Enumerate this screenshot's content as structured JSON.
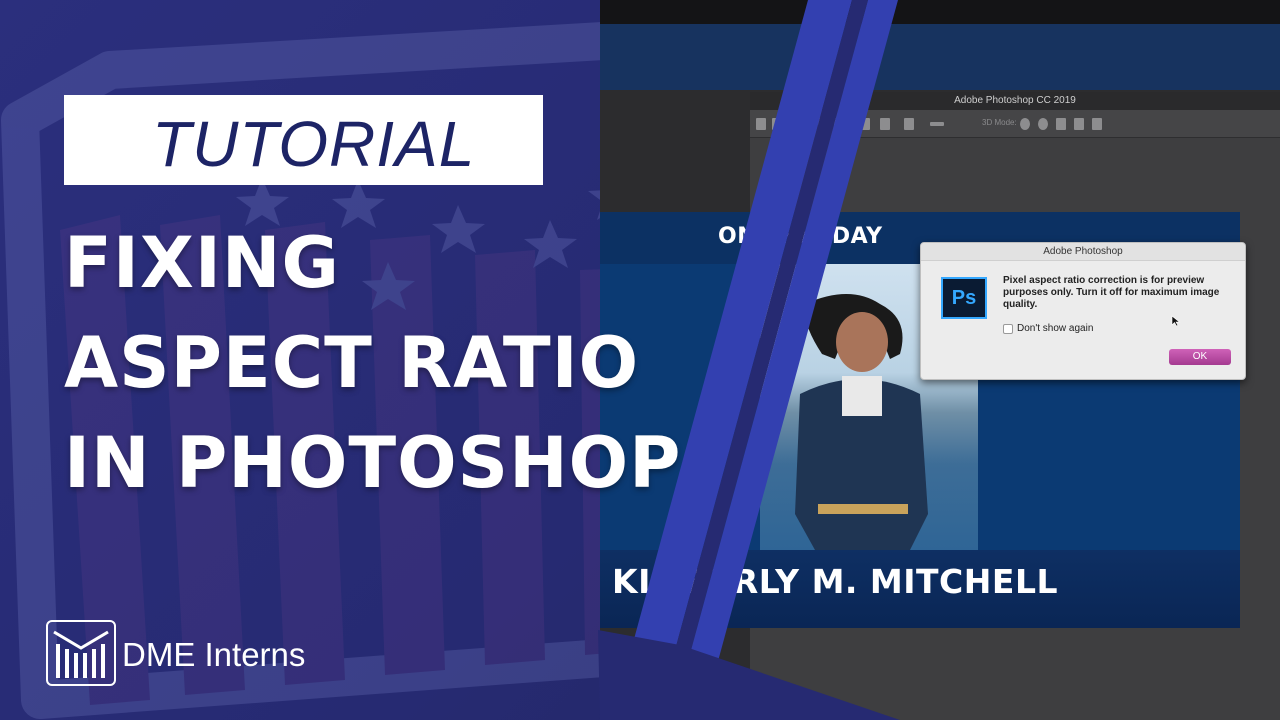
{
  "colors": {
    "background": "#24296b",
    "accent_stripe": "#2f38a6",
    "badge_text": "#1d2466",
    "ok_button": "#b64aa1",
    "ps_blue": "#34a8ff"
  },
  "badge": {
    "label": "TUTORIAL"
  },
  "headline": {
    "line1": "FIXING",
    "line2": "ASPECT RATIO",
    "line3": "IN PHOTOSHOP"
  },
  "brand": {
    "name": "DME Interns",
    "icon": "dme-logo-icon"
  },
  "photoshop": {
    "window_title": "Adobe Photoshop CC 2019",
    "options_bar": {
      "mode_label": "3D Mode:"
    },
    "document": {
      "header_text": "ON THIS DAY",
      "name_text": "KIMBERLY M. MITCHELL"
    },
    "dialog": {
      "title": "Adobe Photoshop",
      "icon": "ps-logo-icon",
      "icon_text": "Ps",
      "message": "Pixel aspect ratio correction is for preview purposes only. Turn it off for maximum image quality.",
      "checkbox_label": "Don't show again",
      "checkbox_checked": false,
      "ok_label": "OK"
    }
  }
}
